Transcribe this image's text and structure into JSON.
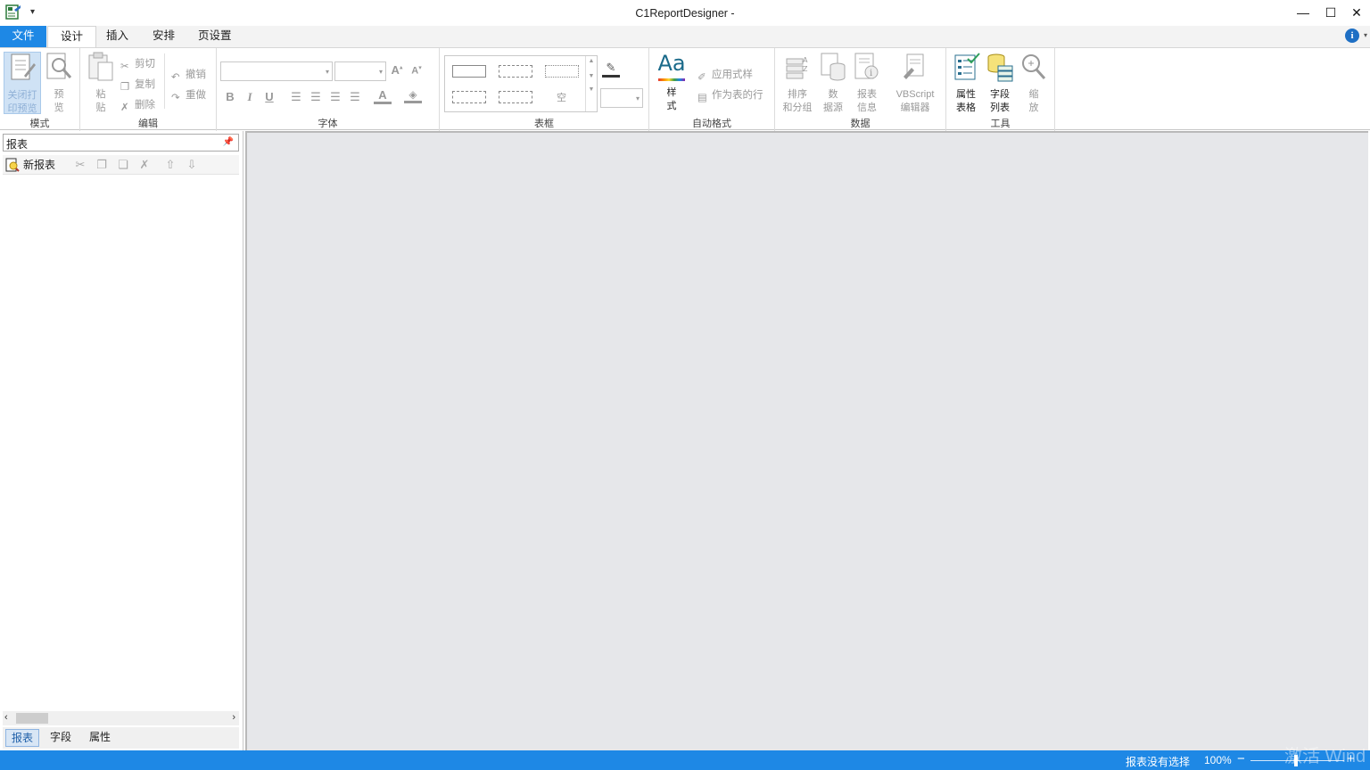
{
  "window": {
    "title": "C1ReportDesigner -",
    "qat_caret": "▾",
    "minimize": "—",
    "maximize": "☐",
    "close": "✕"
  },
  "ribbon_tabs": [
    "文件",
    "设计",
    "插入",
    "安排",
    "页设置"
  ],
  "help": {
    "icon": "i",
    "caret": "▾"
  },
  "groups": {
    "mode": {
      "label": "模式",
      "close_preview": "关闭打\n印预览",
      "preview": "预\n览"
    },
    "edit": {
      "label": "编辑",
      "paste": "粘\n贴",
      "cut": "剪切",
      "copy": "复制",
      "delete": "删除",
      "undo": "撤销",
      "redo": "重做"
    },
    "font": {
      "label": "字体",
      "bold": "B",
      "italic": "I",
      "underline": "U",
      "grow": "A",
      "shrink": "A",
      "color": "A"
    },
    "border": {
      "label": "表框",
      "empty_label": "空"
    },
    "autoformat": {
      "label": "自动格式",
      "style": "样\n式",
      "style_glyph": "Aa",
      "apply_style": "应用式样",
      "as_table_row": "作为表的行"
    },
    "data": {
      "label": "数据",
      "sort_group": "排序\n和分组",
      "datasource": "数\n据源",
      "report_info": "报表\n信息",
      "vbscript": "VBScript\n编辑器"
    },
    "tools": {
      "label": "工具",
      "property_grid": "属性\n表格",
      "field_list": "字段\n列表",
      "zoom": "缩\n放"
    }
  },
  "left_panel": {
    "title": "报表",
    "pin": "ꟷ",
    "new_report": "新报表",
    "bottom_tabs": [
      "报表",
      "字段",
      "属性"
    ]
  },
  "statusbar": {
    "status": "报表没有选择",
    "zoom": "100%",
    "zoom_minus": "−",
    "zoom_plus": "+",
    "watermark": "激活 Wind"
  },
  "colors": {
    "accent": "#1e88e5"
  }
}
